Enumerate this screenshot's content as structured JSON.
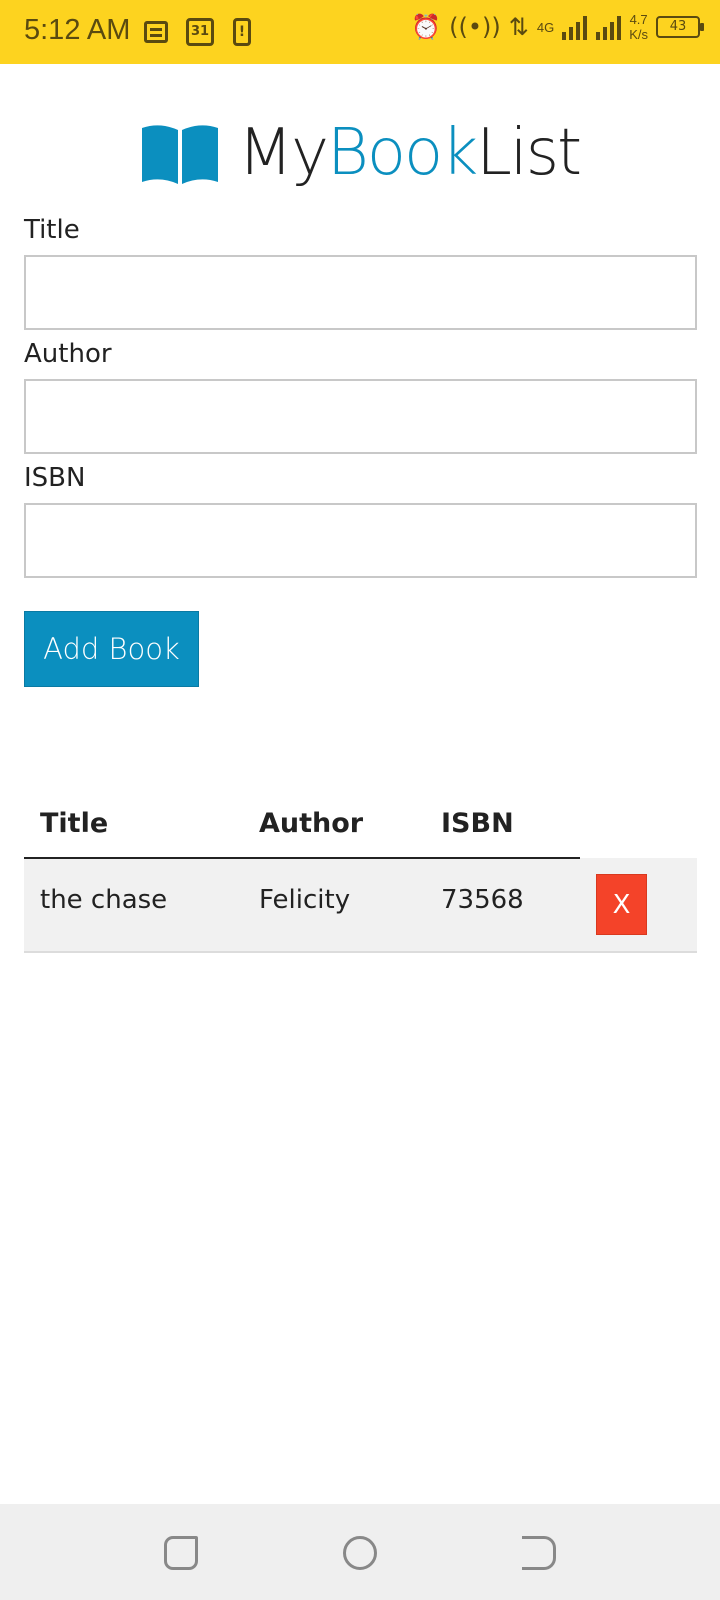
{
  "status_bar": {
    "time": "5:12 AM",
    "calendar_day": "31",
    "alert_glyph": "!",
    "network_type": "4G",
    "net_speed_value": "4.7",
    "net_speed_unit": "K/s",
    "battery": "43",
    "icons": [
      "message-icon",
      "calendar-icon",
      "alert-icon",
      "alarm-icon",
      "hotspot-icon",
      "data-arrows-icon",
      "signal-icon",
      "battery-icon"
    ]
  },
  "logo": {
    "part1": "My",
    "part2": "Book",
    "part3": "List",
    "accent_color": "#0b8fbf"
  },
  "form": {
    "title_label": "Title",
    "title_value": "",
    "author_label": "Author",
    "author_value": "",
    "isbn_label": "ISBN",
    "isbn_value": "",
    "submit_label": "Add Book",
    "submit_color": "#0b8fbf"
  },
  "table": {
    "headers": {
      "title": "Title",
      "author": "Author",
      "isbn": "ISBN"
    },
    "rows": [
      {
        "title": "the chase",
        "author": "Felicity",
        "isbn": "73568",
        "delete_label": "X"
      }
    ],
    "delete_color": "#f44329"
  },
  "nav_bar": {
    "buttons": [
      "recents-icon",
      "home-icon",
      "back-icon"
    ]
  }
}
